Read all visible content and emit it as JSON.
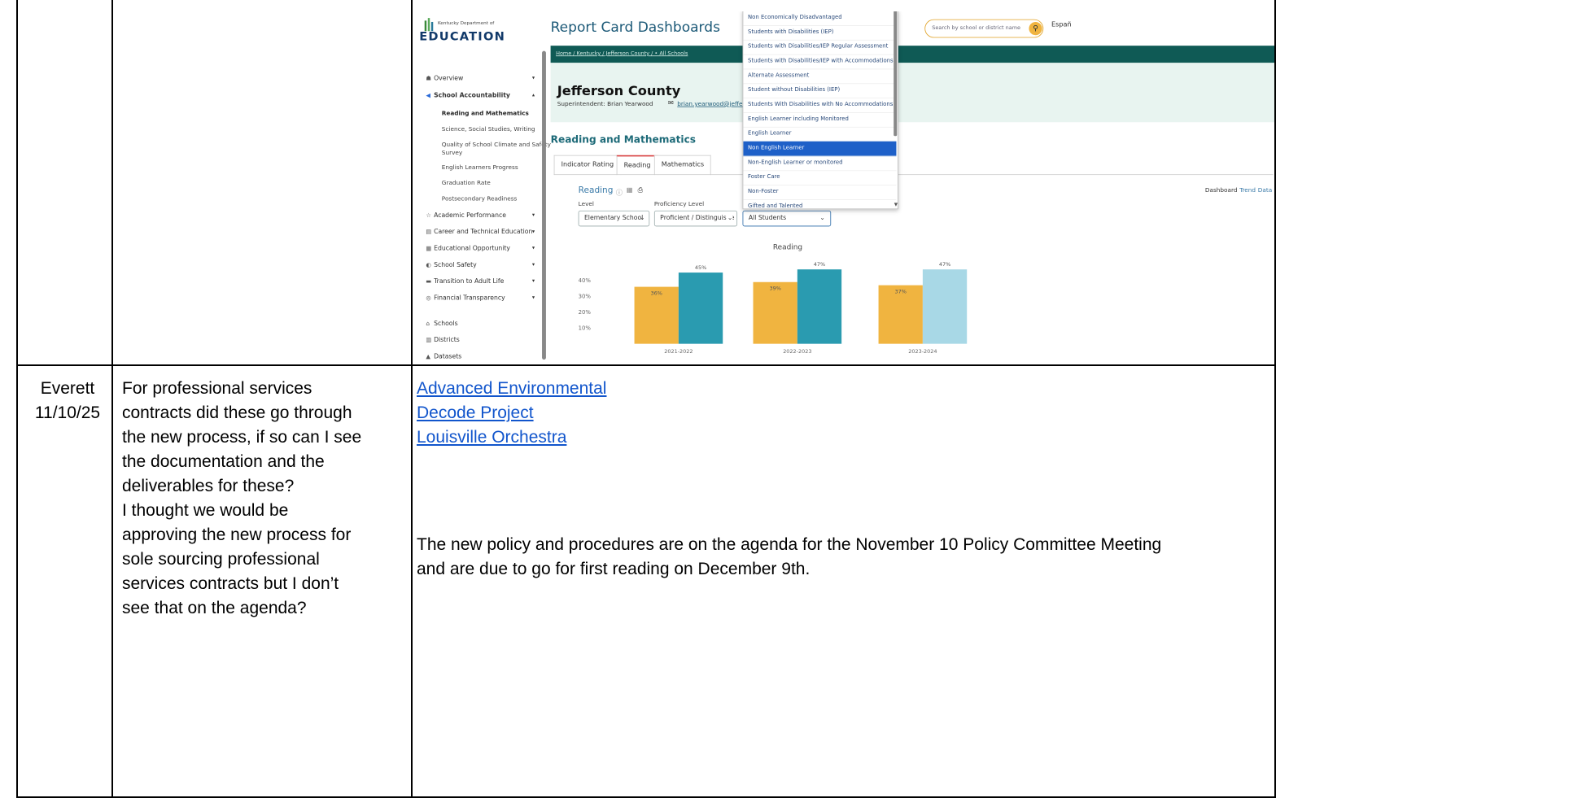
{
  "screenshot": {
    "logo": {
      "line1": "Kentucky Department of",
      "line2": "EDUCATION"
    },
    "header_title": "Report Card Dashboards",
    "search_placeholder": "Search by school or district name",
    "language_link": "Españ",
    "breadcrumb": "Home / Kentucky / Jefferson County / • All Schools",
    "district": {
      "name": "Jefferson County",
      "superintendent": "Superintendent: Brian Yearwood",
      "email": "brian.yearwood@jefferson.kyschoo"
    },
    "section_title": "Reading and Mathematics",
    "tabs": [
      "Indicator Rating",
      "Reading",
      "Mathematics"
    ],
    "panel_title": "Reading",
    "view_links": [
      "Dashboard",
      "Trend",
      "Data"
    ],
    "filters": {
      "level_label": "Level",
      "level_value": "Elementary School",
      "proficiency_label": "Proficiency Level",
      "proficiency_value": "Proficient / Distinguishe",
      "group_value": "All Students"
    },
    "dropdown": [
      "Non Economically Disadvantaged",
      "Students with Disabilities (IEP)",
      "Students with Disabilities/IEP Regular Assessment",
      "Students with Disabilities/IEP with Accommodations",
      "Alternate Assessment",
      "Student without Disabilities (IEP)",
      "Students With Disabilities with No Accommodations",
      "English Learner including Monitored",
      "English Learner",
      "Non English Learner",
      "Non-English Learner or monitored",
      "Foster Care",
      "Non-Foster",
      "Gifted and Talented"
    ],
    "dropdown_selected": 9,
    "sidebar": {
      "items": [
        {
          "icon": "overview-icon",
          "glyph": "☗",
          "label": "Overview",
          "caret": "▾"
        },
        {
          "icon": "accountability-icon",
          "glyph": "◀",
          "label": "School Accountability",
          "caret": "▴"
        }
      ],
      "subitems": [
        "Reading and Mathematics",
        "Science, Social Studies, Writing",
        "Quality of School Climate and Safety",
        "Survey",
        "English Learners Progress",
        "Graduation Rate",
        "Postsecondary Readiness"
      ],
      "sections": [
        {
          "icon": "trophy-icon",
          "glyph": "☆",
          "label": "Academic Performance"
        },
        {
          "icon": "career-icon",
          "glyph": "▤",
          "label": "Career and Technical Education"
        },
        {
          "icon": "opportunity-icon",
          "glyph": "▦",
          "label": "Educational Opportunity"
        },
        {
          "icon": "safety-icon",
          "glyph": "◐",
          "label": "School Safety"
        },
        {
          "icon": "transition-icon",
          "glyph": "▬",
          "label": "Transition to Adult Life"
        },
        {
          "icon": "finance-icon",
          "glyph": "◎",
          "label": "Financial Transparency"
        }
      ],
      "links": [
        {
          "icon": "school-icon",
          "glyph": "⌂",
          "label": "Schools"
        },
        {
          "icon": "district-icon",
          "glyph": "▥",
          "label": "Districts"
        },
        {
          "icon": "dataset-icon",
          "glyph": "▲",
          "label": "Datasets"
        }
      ]
    }
  },
  "chart_data": {
    "type": "bar",
    "title": "Reading",
    "categories": [
      "2021-2022",
      "2022-2023",
      "2023-2024"
    ],
    "series": [
      {
        "values": [
          36,
          39,
          37
        ],
        "color": "#f0b440"
      },
      {
        "values": [
          45,
          47,
          47
        ],
        "color": "#2a9bb0"
      }
    ],
    "bar_label_strings": [
      [
        "36%",
        "45%"
      ],
      [
        "39%",
        "47%"
      ],
      [
        "37%",
        "47%"
      ]
    ],
    "y_ticks": [
      "40%",
      "30%",
      "20%",
      "10%"
    ],
    "ylim": [
      0,
      50
    ],
    "note_last_second_bar_color": "#a8d8e6"
  },
  "row": {
    "requester": {
      "name": "Everett",
      "date": "11/10/25"
    },
    "question_lines": [
      "For professional services",
      "contracts did these go through",
      "the new process, if so can I see",
      "the documentation and the",
      "deliverables for these?",
      "I thought we would be",
      "approving the new process for",
      "sole sourcing professional",
      "services contracts but I don’t",
      "see that on the agenda?"
    ],
    "links": [
      "Advanced Environmental",
      "Decode Project",
      "Louisville Orchestra"
    ],
    "response_lines": [
      "The new policy and procedures are on the agenda for the November 10 Policy Committee Meeting",
      "and are due to go for first reading on December 9th."
    ]
  }
}
